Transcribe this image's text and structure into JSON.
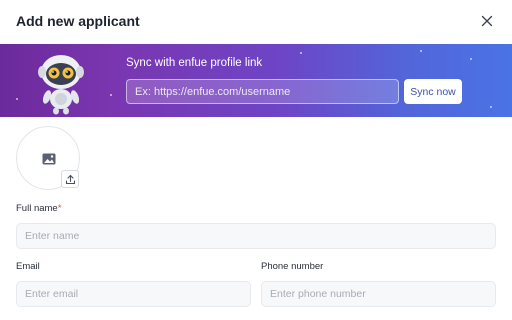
{
  "dialog": {
    "title": "Add new applicant",
    "close_icon": "close-icon"
  },
  "banner": {
    "sync_title": "Sync with enfue profile link",
    "url_placeholder": "Ex: https://enfue.com/username",
    "sync_button": "Sync now",
    "mascot": "robot-mascot",
    "colors": {
      "gradient_start": "#6b2a9b",
      "gradient_end": "#4a73e6"
    }
  },
  "avatar": {
    "placeholder_icon": "image-icon",
    "upload_icon": "upload-icon"
  },
  "form": {
    "full_name": {
      "label": "Full name",
      "required_mark": "*",
      "placeholder": "Enter name"
    },
    "email": {
      "label": "Email",
      "placeholder": "Enter email"
    },
    "phone": {
      "label": "Phone number",
      "placeholder": "Enter phone number"
    }
  }
}
